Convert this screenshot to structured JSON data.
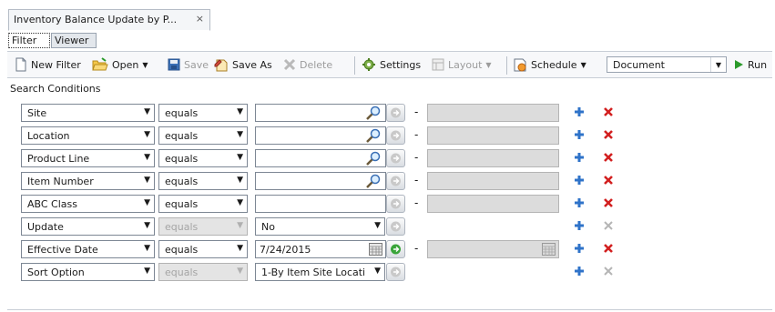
{
  "document_tab": {
    "title": "Inventory Balance Update by P...",
    "close": "×"
  },
  "subtabs": [
    {
      "label": "Filter"
    },
    {
      "label": "Viewer"
    }
  ],
  "toolbar": {
    "new_filter": "New Filter",
    "open": "Open",
    "save": "Save",
    "save_as": "Save As",
    "delete": "Delete",
    "settings": "Settings",
    "layout": "Layout",
    "schedule": "Schedule",
    "output": "Document",
    "run": "Run"
  },
  "search_conditions": {
    "title": "Search Conditions",
    "rows": [
      {
        "field": "Site",
        "operator": "equals",
        "value": ""
      },
      {
        "field": "Location",
        "operator": "equals",
        "value": ""
      },
      {
        "field": "Product Line",
        "operator": "equals",
        "value": ""
      },
      {
        "field": "Item Number",
        "operator": "equals",
        "value": ""
      },
      {
        "field": "ABC Class",
        "operator": "equals",
        "value": ""
      },
      {
        "field": "Update",
        "operator": "equals",
        "value": "No"
      },
      {
        "field": "Effective Date",
        "operator": "equals",
        "value": "7/24/2015"
      },
      {
        "field": "Sort Option",
        "operator": "equals",
        "value": "1-By Item Site Locati"
      }
    ]
  },
  "colors": {
    "accent_blue": "#2f73c9",
    "delete_red": "#d21f1f",
    "disabled_gray": "#a5a5a5",
    "run_green": "#2a9a2a"
  }
}
